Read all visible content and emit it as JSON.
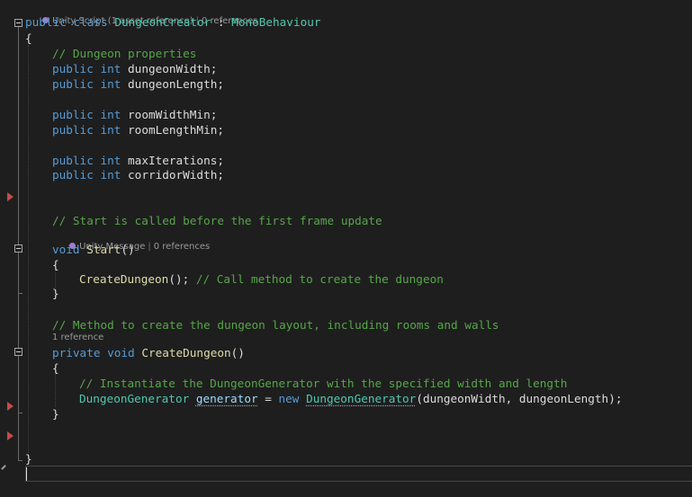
{
  "editor": {
    "background": "#1e1e1e",
    "codelens": {
      "class": {
        "icon": "unity-icon",
        "part1": "Unity Script (1 asset reference)",
        "separator": "|",
        "part2": "0 references"
      },
      "start": {
        "icon": "unity-icon",
        "part1": "Unity Message",
        "separator": "|",
        "part2": "0 references"
      },
      "create": {
        "part1": "1 reference"
      }
    },
    "tokens": {
      "public": "public",
      "class": "class",
      "int": "int",
      "void": "void",
      "private": "private",
      "new": "new",
      "class_name": "DungeonCreator",
      "colon": " : ",
      "base_class": "MonoBehaviour",
      "open_brace": "{",
      "close_brace": "}",
      "semicolon": ";",
      "comment_properties": "// Dungeon properties",
      "field_dungeon_width": "dungeonWidth",
      "field_dungeon_length": "dungeonLength",
      "field_room_width_min": "roomWidthMin",
      "field_room_length_min": "roomLengthMin",
      "field_max_iterations": "maxIterations",
      "field_corridor_width": "corridorWidth",
      "comment_start": "// Start is called before the first frame update",
      "method_start": "Start",
      "parens": "()",
      "call_create": "CreateDungeon",
      "call_suffix": "();",
      "comment_call": " // Call method to create the dungeon",
      "comment_method": "// Method to create the dungeon layout, including rooms and walls",
      "method_create": "CreateDungeon",
      "comment_instantiate": "// Instantiate the DungeonGenerator with the specified width and length",
      "type_generator": "DungeonGenerator",
      "var_generator": "generator",
      "equals": " = ",
      "ctor_args": "(dungeonWidth, dungeonLength);"
    }
  }
}
